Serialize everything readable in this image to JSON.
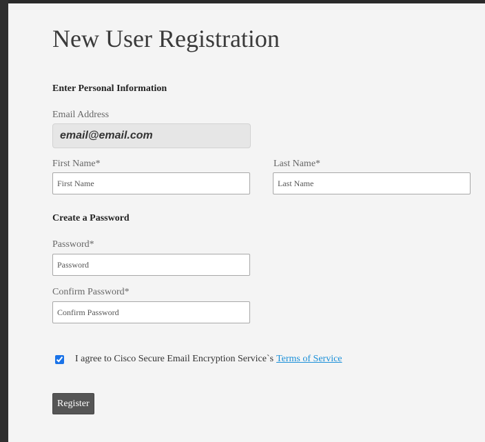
{
  "title": "New User Registration",
  "personal": {
    "heading": "Enter Personal Information",
    "email_label": "Email Address",
    "email_value": "email@email.com",
    "first_name_label": "First Name*",
    "first_name_placeholder": "First Name",
    "last_name_label": "Last Name*",
    "last_name_placeholder": "Last Name"
  },
  "password": {
    "heading": "Create a Password",
    "password_label": "Password*",
    "password_placeholder": "Password",
    "confirm_label": "Confirm Password*",
    "confirm_placeholder": "Confirm Password"
  },
  "agreement": {
    "checked": true,
    "text": "I agree to Cisco Secure Email Encryption Service`s",
    "link": "Terms of Service"
  },
  "register_label": "Register",
  "colors": {
    "link": "#1a8fd8",
    "button": "#555555",
    "checkbox": "#1a73e8"
  }
}
